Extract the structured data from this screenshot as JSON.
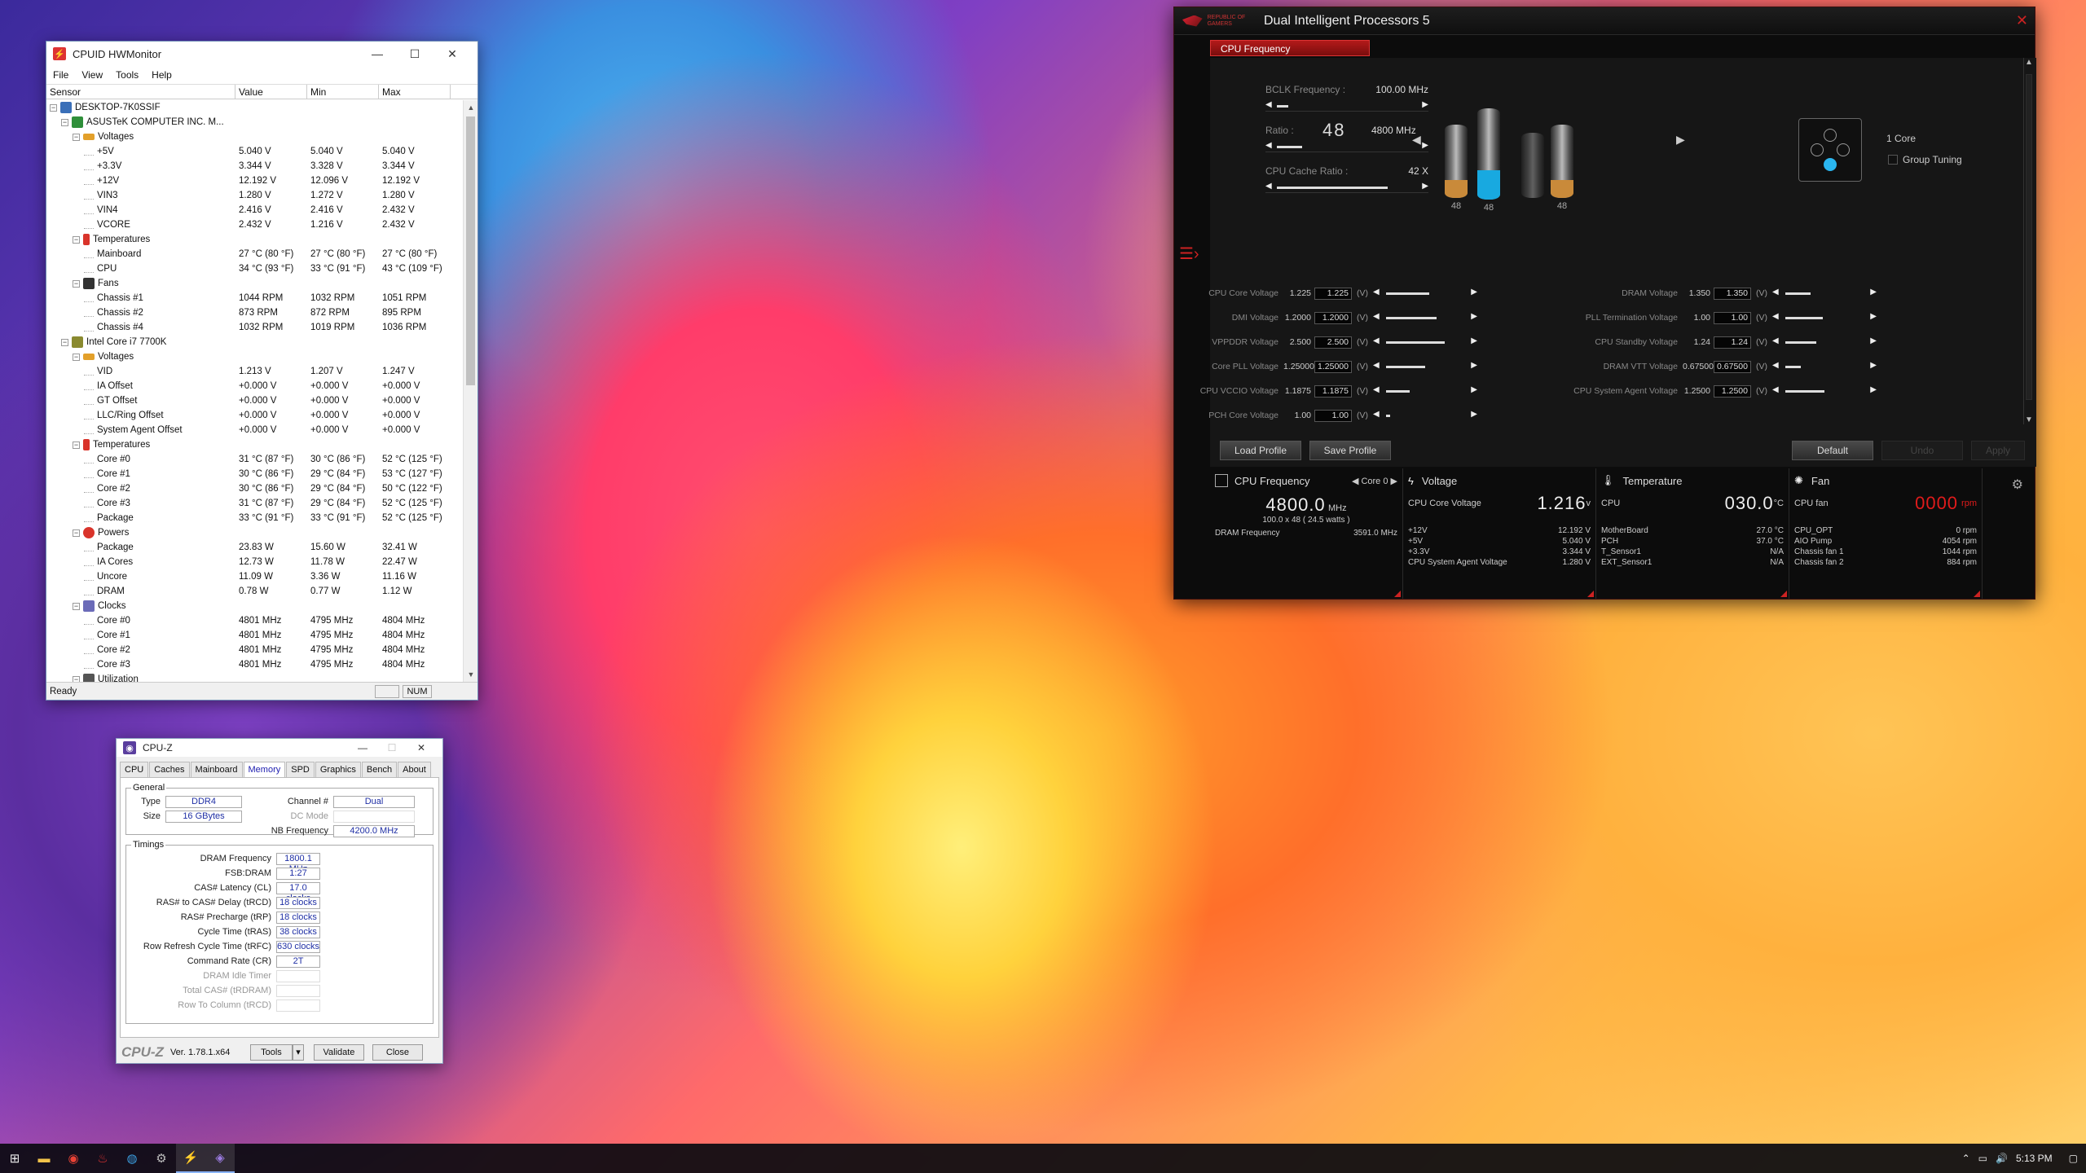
{
  "hwmonitor": {
    "title": "CPUID HWMonitor",
    "menu": [
      "File",
      "View",
      "Tools",
      "Help"
    ],
    "columns": [
      "Sensor",
      "Value",
      "Min",
      "Max"
    ],
    "status": "Ready",
    "num": "NUM",
    "rows": [
      {
        "level": 0,
        "type": "node",
        "icon": "pc-icon",
        "name": "DESKTOP-7K0SSIF",
        "value": "",
        "min": "",
        "max": ""
      },
      {
        "level": 1,
        "type": "node",
        "icon": "motherboard-icon",
        "name": "ASUSTeK COMPUTER INC. M...",
        "value": "",
        "min": "",
        "max": ""
      },
      {
        "level": 2,
        "type": "node",
        "icon": "voltage-icon",
        "name": "Voltages",
        "value": "",
        "min": "",
        "max": ""
      },
      {
        "level": 3,
        "type": "leaf",
        "name": "+5V",
        "value": "5.040 V",
        "min": "5.040 V",
        "max": "5.040 V"
      },
      {
        "level": 3,
        "type": "leaf",
        "name": "+3.3V",
        "value": "3.344 V",
        "min": "3.328 V",
        "max": "3.344 V"
      },
      {
        "level": 3,
        "type": "leaf",
        "name": "+12V",
        "value": "12.192 V",
        "min": "12.096 V",
        "max": "12.192 V"
      },
      {
        "level": 3,
        "type": "leaf",
        "name": "VIN3",
        "value": "1.280 V",
        "min": "1.272 V",
        "max": "1.280 V"
      },
      {
        "level": 3,
        "type": "leaf",
        "name": "VIN4",
        "value": "2.416 V",
        "min": "2.416 V",
        "max": "2.432 V"
      },
      {
        "level": 3,
        "type": "leaf",
        "name": "VCORE",
        "value": "2.432 V",
        "min": "1.216 V",
        "max": "2.432 V"
      },
      {
        "level": 2,
        "type": "node",
        "icon": "temperature-icon",
        "name": "Temperatures",
        "value": "",
        "min": "",
        "max": ""
      },
      {
        "level": 3,
        "type": "leaf",
        "name": "Mainboard",
        "value": "27 °C  (80 °F)",
        "min": "27 °C  (80 °F)",
        "max": "27 °C  (80 °F)"
      },
      {
        "level": 3,
        "type": "leaf",
        "name": "CPU",
        "value": "34 °C  (93 °F)",
        "min": "33 °C  (91 °F)",
        "max": "43 °C  (109 °F)"
      },
      {
        "level": 2,
        "type": "node",
        "icon": "fan-icon",
        "name": "Fans",
        "value": "",
        "min": "",
        "max": ""
      },
      {
        "level": 3,
        "type": "leaf",
        "name": "Chassis #1",
        "value": "1044 RPM",
        "min": "1032 RPM",
        "max": "1051 RPM"
      },
      {
        "level": 3,
        "type": "leaf",
        "name": "Chassis #2",
        "value": "873 RPM",
        "min": "872 RPM",
        "max": "895 RPM"
      },
      {
        "level": 3,
        "type": "leaf",
        "name": "Chassis #4",
        "value": "1032 RPM",
        "min": "1019 RPM",
        "max": "1036 RPM"
      },
      {
        "level": 1,
        "type": "node",
        "icon": "cpu-icon",
        "name": "Intel Core i7 7700K",
        "value": "",
        "min": "",
        "max": ""
      },
      {
        "level": 2,
        "type": "node",
        "icon": "voltage-icon",
        "name": "Voltages",
        "value": "",
        "min": "",
        "max": ""
      },
      {
        "level": 3,
        "type": "leaf",
        "name": "VID",
        "value": "1.213 V",
        "min": "1.207 V",
        "max": "1.247 V"
      },
      {
        "level": 3,
        "type": "leaf",
        "name": "IA Offset",
        "value": "+0.000 V",
        "min": "+0.000 V",
        "max": "+0.000 V"
      },
      {
        "level": 3,
        "type": "leaf",
        "name": "GT Offset",
        "value": "+0.000 V",
        "min": "+0.000 V",
        "max": "+0.000 V"
      },
      {
        "level": 3,
        "type": "leaf",
        "name": "LLC/Ring Offset",
        "value": "+0.000 V",
        "min": "+0.000 V",
        "max": "+0.000 V"
      },
      {
        "level": 3,
        "type": "leaf",
        "name": "System Agent Offset",
        "value": "+0.000 V",
        "min": "+0.000 V",
        "max": "+0.000 V"
      },
      {
        "level": 2,
        "type": "node",
        "icon": "temperature-icon",
        "name": "Temperatures",
        "value": "",
        "min": "",
        "max": ""
      },
      {
        "level": 3,
        "type": "leaf",
        "name": "Core #0",
        "value": "31 °C  (87 °F)",
        "min": "30 °C  (86 °F)",
        "max": "52 °C  (125 °F)"
      },
      {
        "level": 3,
        "type": "leaf",
        "name": "Core #1",
        "value": "30 °C  (86 °F)",
        "min": "29 °C  (84 °F)",
        "max": "53 °C  (127 °F)"
      },
      {
        "level": 3,
        "type": "leaf",
        "name": "Core #2",
        "value": "30 °C  (86 °F)",
        "min": "29 °C  (84 °F)",
        "max": "50 °C  (122 °F)"
      },
      {
        "level": 3,
        "type": "leaf",
        "name": "Core #3",
        "value": "31 °C  (87 °F)",
        "min": "29 °C  (84 °F)",
        "max": "52 °C  (125 °F)"
      },
      {
        "level": 3,
        "type": "leaf",
        "name": "Package",
        "value": "33 °C  (91 °F)",
        "min": "33 °C  (91 °F)",
        "max": "52 °C  (125 °F)"
      },
      {
        "level": 2,
        "type": "node",
        "icon": "power-icon",
        "name": "Powers",
        "value": "",
        "min": "",
        "max": ""
      },
      {
        "level": 3,
        "type": "leaf",
        "name": "Package",
        "value": "23.83 W",
        "min": "15.60 W",
        "max": "32.41 W"
      },
      {
        "level": 3,
        "type": "leaf",
        "name": "IA Cores",
        "value": "12.73 W",
        "min": "11.78 W",
        "max": "22.47 W"
      },
      {
        "level": 3,
        "type": "leaf",
        "name": "Uncore",
        "value": "11.09 W",
        "min": "3.36 W",
        "max": "11.16 W"
      },
      {
        "level": 3,
        "type": "leaf",
        "name": "DRAM",
        "value": "0.78 W",
        "min": "0.77 W",
        "max": "1.12 W"
      },
      {
        "level": 2,
        "type": "node",
        "icon": "clock-icon",
        "name": "Clocks",
        "value": "",
        "min": "",
        "max": ""
      },
      {
        "level": 3,
        "type": "leaf",
        "name": "Core #0",
        "value": "4801 MHz",
        "min": "4795 MHz",
        "max": "4804 MHz"
      },
      {
        "level": 3,
        "type": "leaf",
        "name": "Core #1",
        "value": "4801 MHz",
        "min": "4795 MHz",
        "max": "4804 MHz"
      },
      {
        "level": 3,
        "type": "leaf",
        "name": "Core #2",
        "value": "4801 MHz",
        "min": "4795 MHz",
        "max": "4804 MHz"
      },
      {
        "level": 3,
        "type": "leaf",
        "name": "Core #3",
        "value": "4801 MHz",
        "min": "4795 MHz",
        "max": "4804 MHz"
      },
      {
        "level": 2,
        "type": "node",
        "icon": "utilization-icon",
        "name": "Utilization",
        "value": "",
        "min": "",
        "max": ""
      }
    ]
  },
  "cpuz": {
    "title": "CPU-Z",
    "tabs": [
      "CPU",
      "Caches",
      "Mainboard",
      "Memory",
      "SPD",
      "Graphics",
      "Bench",
      "About"
    ],
    "active_tab": "Memory",
    "general_label": "General",
    "type_label": "Type",
    "type": "DDR4",
    "size_label": "Size",
    "size": "16 GBytes",
    "channel_label": "Channel #",
    "channel": "Dual",
    "dcmode_label": "DC Mode",
    "dcmode": "",
    "nbfreq_label": "NB Frequency",
    "nbfreq": "4200.0 MHz",
    "timings_label": "Timings",
    "timings": [
      {
        "label": "DRAM Frequency",
        "value": "1800.1 MHz",
        "disabled": false
      },
      {
        "label": "FSB:DRAM",
        "value": "1:27",
        "disabled": false
      },
      {
        "label": "CAS# Latency (CL)",
        "value": "17.0 clocks",
        "disabled": false
      },
      {
        "label": "RAS# to CAS# Delay (tRCD)",
        "value": "18 clocks",
        "disabled": false
      },
      {
        "label": "RAS# Precharge (tRP)",
        "value": "18 clocks",
        "disabled": false
      },
      {
        "label": "Cycle Time (tRAS)",
        "value": "38 clocks",
        "disabled": false
      },
      {
        "label": "Row Refresh Cycle Time (tRFC)",
        "value": "630 clocks",
        "disabled": false
      },
      {
        "label": "Command Rate (CR)",
        "value": "2T",
        "disabled": false
      },
      {
        "label": "DRAM Idle Timer",
        "value": "",
        "disabled": true
      },
      {
        "label": "Total CAS# (tRDRAM)",
        "value": "",
        "disabled": true
      },
      {
        "label": "Row To Column (tRCD)",
        "value": "",
        "disabled": true
      }
    ],
    "brand": "CPU-Z",
    "version": "Ver. 1.78.1.x64",
    "tools_btn": "Tools",
    "validate_btn": "Validate",
    "close_btn": "Close"
  },
  "dip": {
    "title": "Dual Intelligent Processors 5",
    "rog_text": "REPUBLIC OF GAMERS",
    "tab": "CPU Frequency",
    "bclk_label": "BCLK Frequency :",
    "bclk_value": "100.00 MHz",
    "bclk_level": 0.08,
    "ratio_label": "Ratio :",
    "ratio_big": "48",
    "ratio_mhz": "4800 MHz",
    "ratio_level": 0.18,
    "cache_label": "CPU Cache Ratio :",
    "cache_value": "42 X",
    "cache_level": 0.8,
    "cores": [
      {
        "label": "48",
        "fill": 0.25,
        "color": "#c98a3a"
      },
      {
        "label": "48",
        "fill": 0.32,
        "color": "#18a9e0"
      },
      {
        "label": "",
        "fill": 0.0,
        "color": "#555"
      },
      {
        "label": "48",
        "fill": 0.25,
        "color": "#c98a3a"
      }
    ],
    "one_core": "1 Core",
    "group_tuning": "Group Tuning",
    "voltages_left": [
      {
        "label": "CPU Core Voltage",
        "cur": "1.225",
        "input": "1.225",
        "unit": "(V)",
        "level": 0.55
      },
      {
        "label": "DMI Voltage",
        "cur": "1.2000",
        "input": "1.2000",
        "unit": "(V)",
        "level": 0.65
      },
      {
        "label": "VPPDDR Voltage",
        "cur": "2.500",
        "input": "2.500",
        "unit": "(V)",
        "level": 0.75
      },
      {
        "label": "Core PLL Voltage",
        "cur": "1.25000",
        "input": "1.25000",
        "unit": "(V)",
        "level": 0.5
      },
      {
        "label": "CPU VCCIO Voltage",
        "cur": "1.1875",
        "input": "1.1875",
        "unit": "(V)",
        "level": 0.3
      },
      {
        "label": "PCH Core Voltage",
        "cur": "1.00",
        "input": "1.00",
        "unit": "(V)",
        "level": 0.05
      }
    ],
    "voltages_right": [
      {
        "label": "DRAM Voltage",
        "cur": "1.350",
        "input": "1.350",
        "unit": "(V)",
        "level": 0.32
      },
      {
        "label": "PLL Termination Voltage",
        "cur": "1.00",
        "input": "1.00",
        "unit": "(V)",
        "level": 0.48
      },
      {
        "label": "CPU Standby Voltage",
        "cur": "1.24",
        "input": "1.24",
        "unit": "(V)",
        "level": 0.4
      },
      {
        "label": "DRAM VTT Voltage",
        "cur": "0.67500",
        "input": "0.67500",
        "unit": "(V)",
        "level": 0.2
      },
      {
        "label": "CPU System Agent Voltage",
        "cur": "1.2500",
        "input": "1.2500",
        "unit": "(V)",
        "level": 0.5
      }
    ],
    "buttons": {
      "load": "Load Profile",
      "save": "Save Profile",
      "default": "Default",
      "undo": "Undo",
      "apply": "Apply"
    },
    "panel_freq": {
      "title": "CPU Frequency",
      "core_select": "Core 0",
      "big": "4800.0",
      "unit": "MHz",
      "sub": "100.0  x  48   ( 24.5    watts )",
      "dram_label": "DRAM Frequency",
      "dram_value": "3591.0  MHz"
    },
    "panel_volt": {
      "title": "Voltage",
      "main_label": "CPU Core Voltage",
      "big": "1.216",
      "unit": "v",
      "rows": [
        {
          "k": "+12V",
          "v": "12.192 V"
        },
        {
          "k": "+5V",
          "v": "5.040 V"
        },
        {
          "k": "+3.3V",
          "v": "3.344 V"
        },
        {
          "k": "CPU System Agent Voltage",
          "v": "1.280 V"
        }
      ]
    },
    "panel_temp": {
      "title": "Temperature",
      "main_label": "CPU",
      "big": "030.0",
      "unit": "°C",
      "rows": [
        {
          "k": "MotherBoard",
          "v": "27.0 °C"
        },
        {
          "k": "PCH",
          "v": "37.0 °C"
        },
        {
          "k": "T_Sensor1",
          "v": "N/A"
        },
        {
          "k": "EXT_Sensor1",
          "v": "N/A"
        }
      ]
    },
    "panel_fan": {
      "title": "Fan",
      "main_label": "CPU fan",
      "big": "0000",
      "unit": "rpm",
      "rows": [
        {
          "k": "CPU_OPT",
          "v": "0  rpm"
        },
        {
          "k": "AIO Pump",
          "v": "4054  rpm"
        },
        {
          "k": "Chassis fan 1",
          "v": "1044  rpm"
        },
        {
          "k": "Chassis fan 2",
          "v": "884  rpm"
        }
      ]
    }
  },
  "taskbar": {
    "icons": [
      "windows-start-icon",
      "file-explorer-icon",
      "chrome-icon",
      "hwmonitor-icon",
      "edge-icon",
      "steam-icon",
      "dip5-icon",
      "cpuz-icon"
    ],
    "time": "5:13 PM"
  }
}
